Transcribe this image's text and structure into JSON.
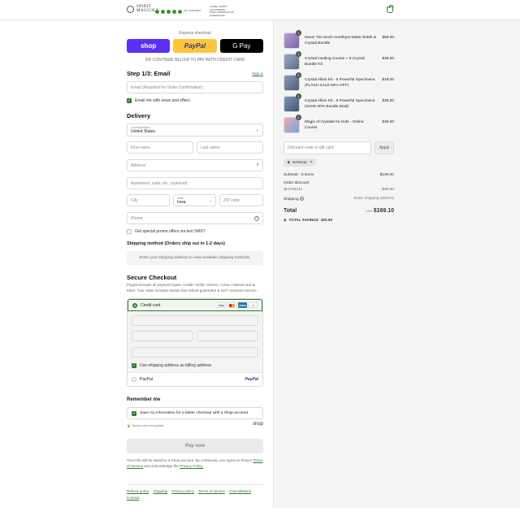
{
  "header": {
    "brand_line1": "SPIRIT",
    "brand_line2": "MAGICKA",
    "badge1": "24/7 SUPPORT",
    "badge2": "12,000+ HAPPY CUSTOMERS",
    "badge3": "100% SATISFACTION GUARANTEE"
  },
  "express": {
    "title": "Express checkout",
    "shop_label": "shop",
    "paypal_label": "PayPal",
    "gpay_label": "G Pay",
    "divider": "OR CONTINUE BELOW TO PAY WITH CREDIT CARD"
  },
  "email_step": {
    "title": "Step 1/3: Email",
    "signin": "Sign in",
    "email_placeholder": "Email (Required for Order Confirmation)",
    "news_label": "Email me with news and offers"
  },
  "delivery": {
    "title": "Delivery",
    "country_label": "Country/Region",
    "country_value": "United States",
    "first_name": "First name",
    "last_name": "Last name",
    "address": "Address",
    "apartment": "Apartment, suite, etc. (optional)",
    "city": "City",
    "state_label": "State",
    "state_value": "Iowa",
    "zip": "ZIP code",
    "phone": "Phone",
    "sms_label": "Get special promo offers via text SMS?"
  },
  "shipping": {
    "title": "Shipping method (Orders ship out in 1-2 days)",
    "note": "Enter your shipping address to view available shipping methods."
  },
  "payment": {
    "title": "Secure Checkout",
    "desc": "Paypal accepts all payment types. Credit / Debit / Diners / Amex / Mastercard & More. Your order includes hassle free refund guarantee & 24/7 customer service.",
    "credit_card": "Credit card",
    "card_logos": [
      "VISA",
      "MC",
      "AMEX",
      "+2"
    ],
    "billing_label": "Use shipping address as billing address",
    "paypal": "PayPal",
    "paypal_logo": "PayPal"
  },
  "remember": {
    "title": "Remember me",
    "save_label": "Save my information for a faster checkout with a Shop account",
    "secure_note": "Secure and encrypted",
    "shop_logo": "shop"
  },
  "pay_now": "Pay now",
  "legal": {
    "text1": "Your info will be saved to a Shop account. By continuing, you agree to Shop's",
    "terms": "Terms of Service",
    "text2": "and acknowledge the",
    "privacy": "Privacy Policy."
  },
  "footer_links": [
    "Refund policy",
    "Shipping",
    "Privacy policy",
    "Terms of service",
    "Cancellations",
    "Contact"
  ],
  "cart": {
    "items": [
      {
        "name": "Never Too Much Amethyst Water Bottle & Crystal Bundle",
        "price": "$59.00",
        "qty": "1",
        "color": "#7b5ea7"
      },
      {
        "name": "Crystal Healing Course + 8 Crystal Bundle Kit",
        "price": "$39.00",
        "qty": "1",
        "color": "#5d6b8a"
      },
      {
        "name": "Crystal Allies Kit - 6 Powerful Specimens (FLASH SALE 62% OFF)",
        "price": "$18.00",
        "qty": "1",
        "color": "#4a5e7a"
      },
      {
        "name": "Crystal Allies Kit - 6 Powerful Specimens (SAVE 60% Bundle Deal)",
        "price": "$36.00",
        "qty": "1",
        "color": "#3f5a78"
      },
      {
        "name": "Magic of Crystals for Kids - Online Course",
        "price": "$38.00",
        "qty": "1",
        "color": "#c0556e"
      }
    ],
    "discount_placeholder": "Discount code or gift card",
    "apply": "Apply",
    "code_tag": "HANA11",
    "subtotal_label": "Subtotal · 5 items",
    "subtotal": "$190.00",
    "order_discount": "Order discount",
    "discount_code": "HANA11",
    "discount_amount": "- $20.90",
    "shipping_label": "Shipping",
    "shipping_value": "Enter shipping address",
    "total_label": "Total",
    "currency": "USD",
    "total": "$169.10",
    "savings_label": "TOTAL SAVINGS",
    "savings": "$20.90"
  }
}
